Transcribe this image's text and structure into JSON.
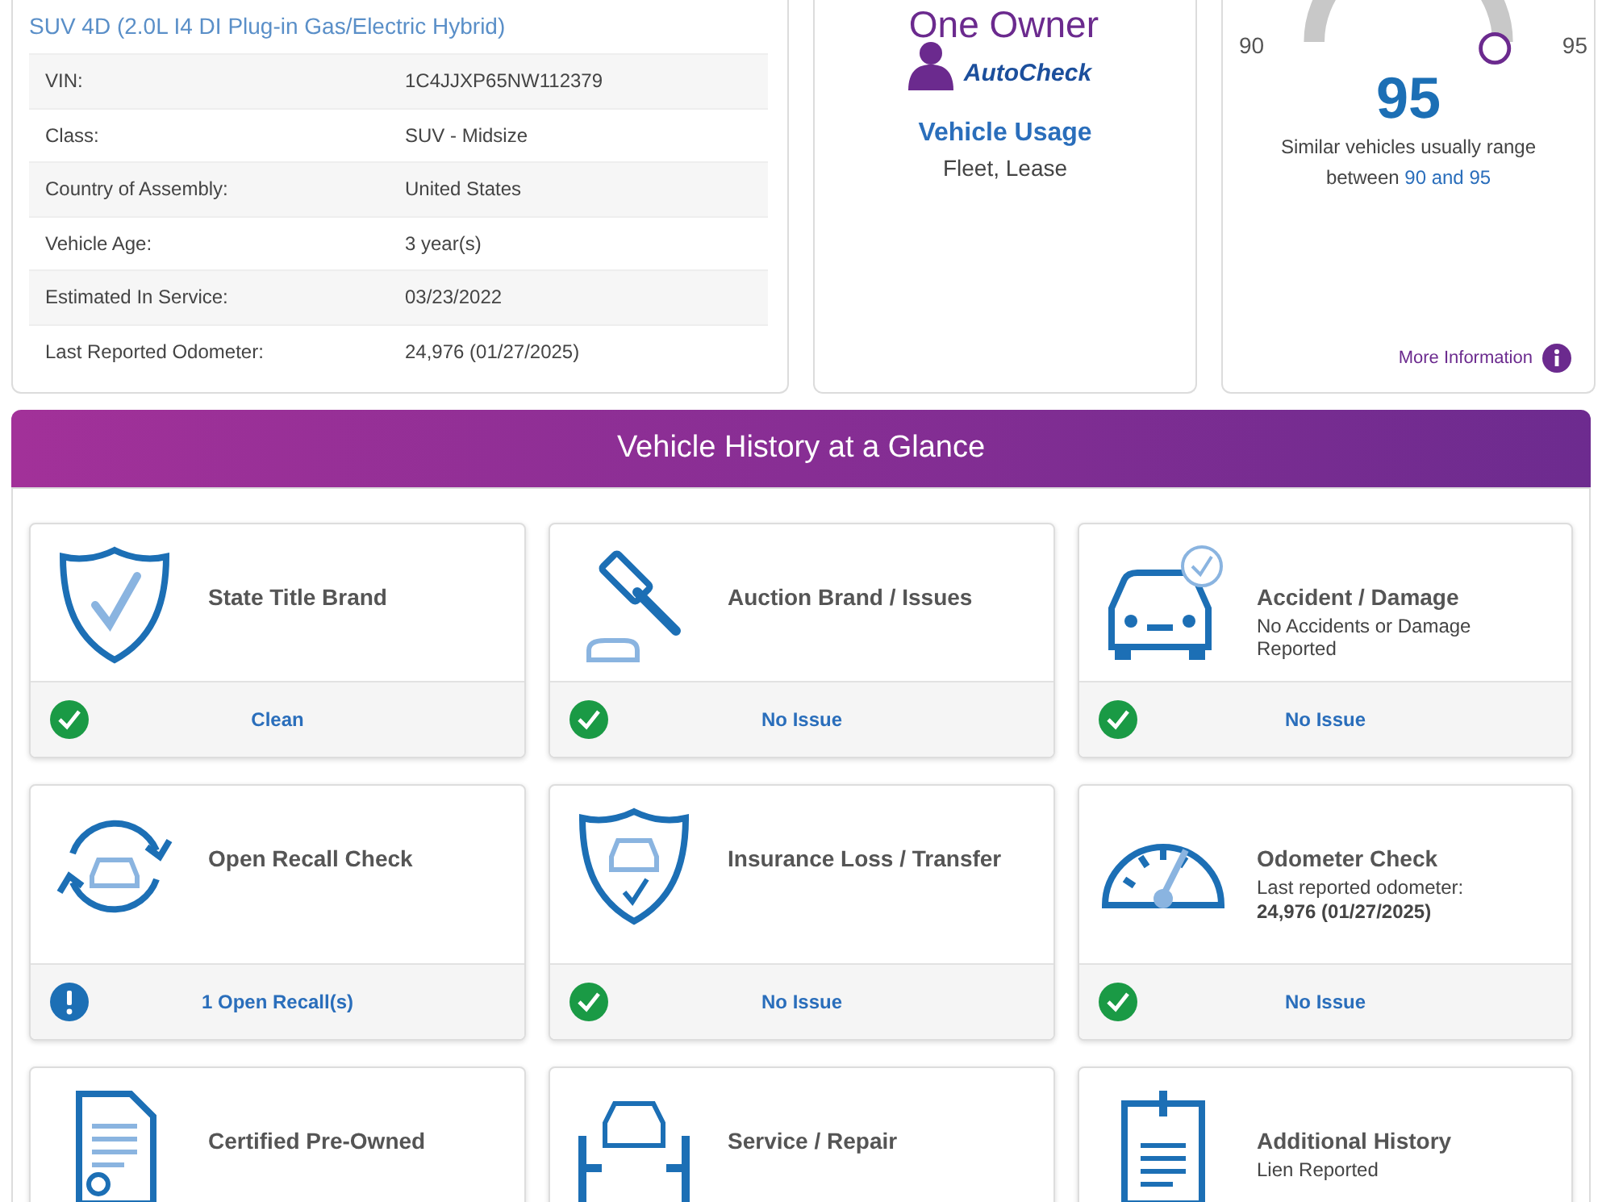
{
  "vehicle": {
    "subtitle": "SUV 4D (2.0L I4 DI Plug-in Gas/Electric Hybrid)",
    "specs": [
      {
        "label": "VIN:",
        "value": "1C4JJXP65NW112379"
      },
      {
        "label": "Class:",
        "value": "SUV - Midsize"
      },
      {
        "label": "Country of Assembly:",
        "value": "United States"
      },
      {
        "label": "Vehicle Age:",
        "value": "3 year(s)"
      },
      {
        "label": "Estimated In Service:",
        "value": "03/23/2022"
      },
      {
        "label": "Last Reported Odometer:",
        "value": "24,976 (01/27/2025)"
      }
    ]
  },
  "usage": {
    "badge_title": "One Owner",
    "badge_brand": "AutoCheck",
    "title": "Vehicle Usage",
    "value": "Fleet, Lease"
  },
  "score": {
    "min_label": "90",
    "max_label": "95",
    "value": "95",
    "range_text": "Similar vehicles usually range between",
    "range_values": "90 and 95",
    "more_info": "More Information"
  },
  "history": {
    "title": "Vehicle History at a Glance",
    "items": [
      {
        "kind": "shield",
        "title": "State Title Brand",
        "status": {
          "kind": "ok",
          "text": "Clean"
        }
      },
      {
        "kind": "gavel",
        "title": "Auction Brand / Issues",
        "status": {
          "kind": "ok",
          "text": "No Issue"
        }
      },
      {
        "kind": "car",
        "title": "Accident / Damage",
        "details": [
          {
            "text": "No Accidents or Damage Reported",
            "bold": false
          }
        ],
        "status": {
          "kind": "ok",
          "text": "No Issue"
        }
      },
      {
        "kind": "recall",
        "title": "Open Recall Check",
        "status": {
          "kind": "alert",
          "text": "1 Open Recall(s)"
        }
      },
      {
        "kind": "insurance",
        "title": "Insurance Loss / Transfer",
        "status": {
          "kind": "ok",
          "text": "No Issue"
        }
      },
      {
        "kind": "odometer",
        "title": "Odometer Check",
        "details": [
          {
            "text": "Last reported odometer:",
            "bold": false
          },
          {
            "text": "24,976 (01/27/2025)",
            "bold": true
          }
        ],
        "status": {
          "kind": "ok",
          "text": "No Issue"
        }
      },
      {
        "kind": "certificate",
        "title": "Certified Pre-Owned"
      },
      {
        "kind": "lift",
        "title": "Service / Repair"
      },
      {
        "kind": "clipboard",
        "title": "Additional History",
        "details": [
          {
            "text": "Lien Reported",
            "bold": false
          }
        ]
      }
    ]
  }
}
